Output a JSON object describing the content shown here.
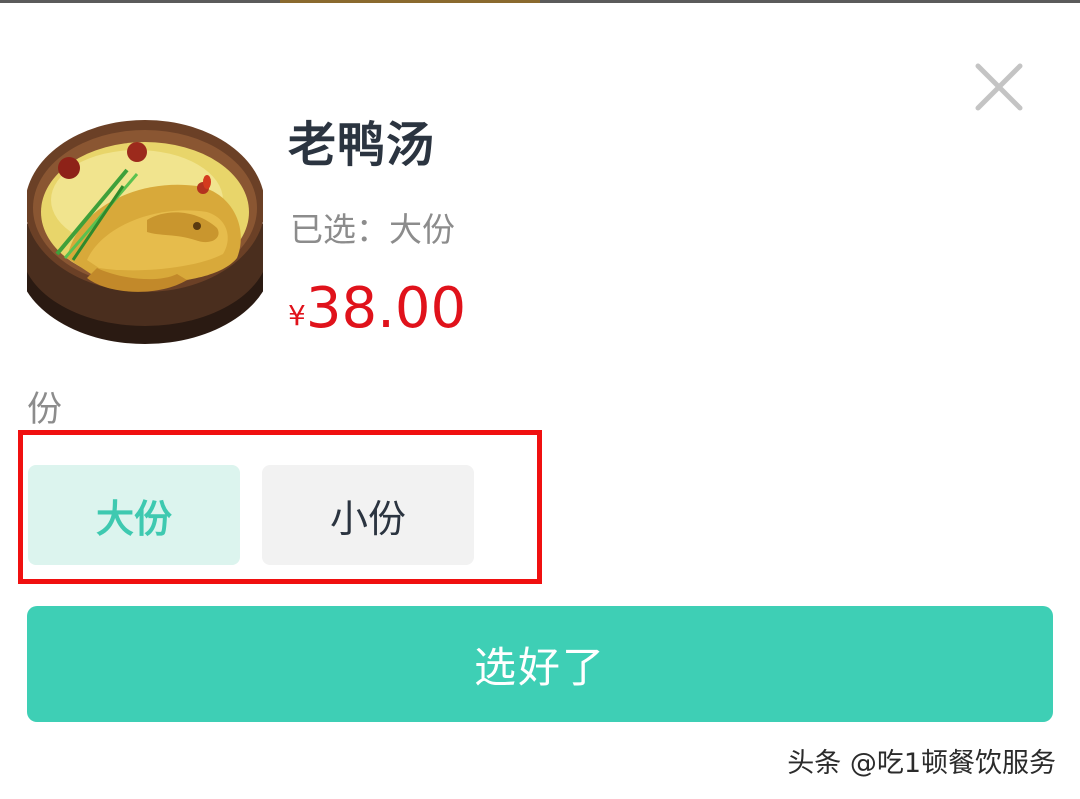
{
  "product": {
    "name": "老鸭汤",
    "selected_text": "已选：大份",
    "price_currency": "¥",
    "price_amount": "38.00",
    "image": "duck-soup-clay-pot"
  },
  "spec": {
    "title": "份",
    "options": [
      {
        "label": "大份",
        "selected": true
      },
      {
        "label": "小份",
        "selected": false
      }
    ]
  },
  "actions": {
    "confirm_label": "选好了",
    "close_icon": "close-icon"
  },
  "watermark": "头条 @吃1顿餐饮服务",
  "colors": {
    "accent": "#3ecfb5",
    "selected_bg": "#dcf4ee",
    "selected_text": "#3ec9b0",
    "price": "#e0121b",
    "highlight_border": "#f01010"
  }
}
